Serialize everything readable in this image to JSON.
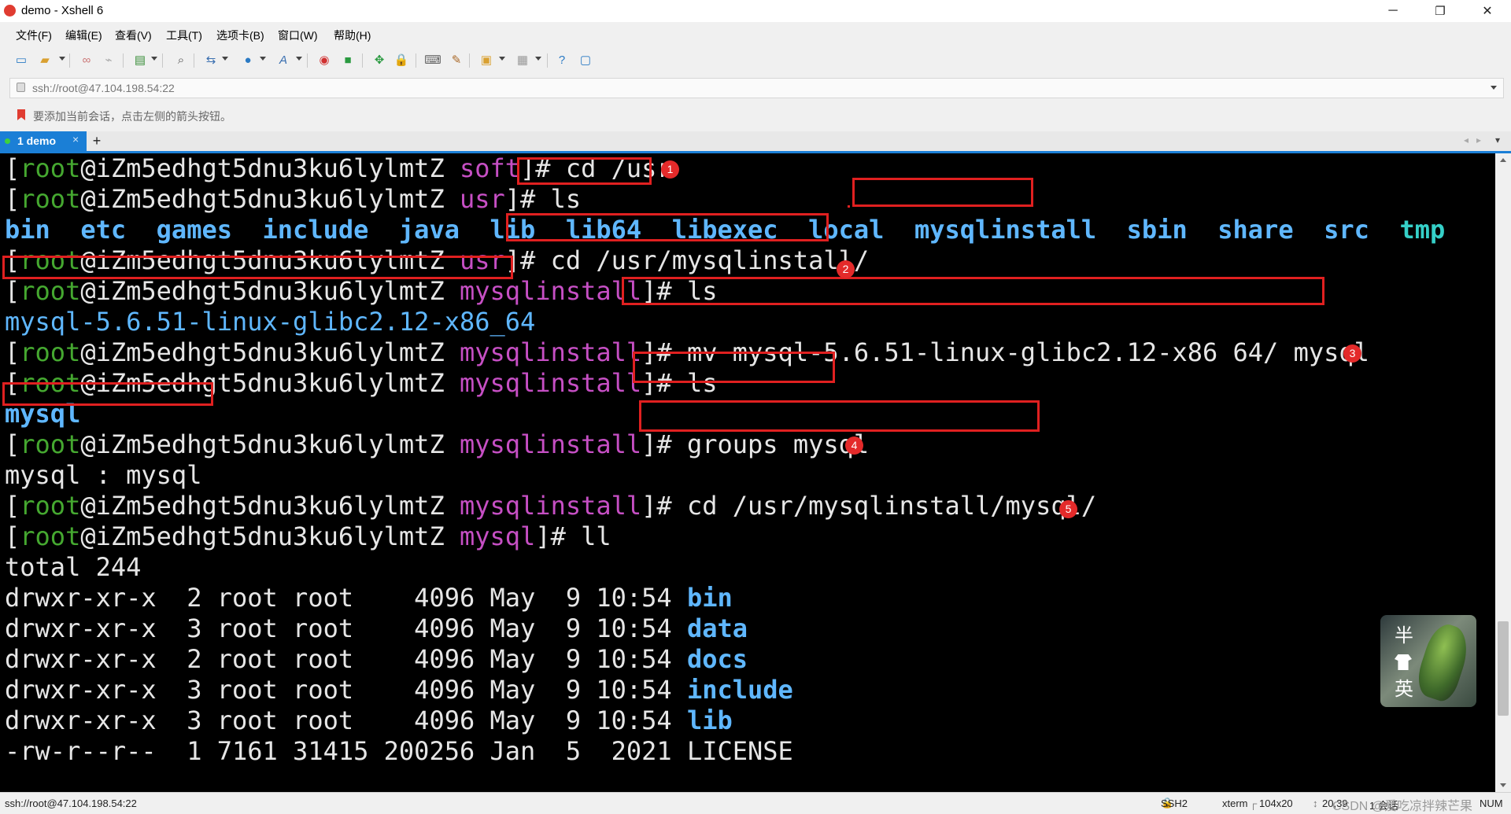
{
  "window": {
    "title": "demo - Xshell 6",
    "controls": {
      "minimize": "─",
      "restore": "❐",
      "close": "✕"
    }
  },
  "menu": [
    "文件(F)",
    "编辑(E)",
    "查看(V)",
    "工具(T)",
    "选项卡(B)",
    "窗口(W)",
    "帮助(H)"
  ],
  "toolbar_icons": [
    "new-session-icon",
    "open-folder-icon",
    "link-icon",
    "unlink-icon",
    "properties-icon",
    "search-icon",
    "transfer-icon",
    "globe-icon",
    "font-icon",
    "xftp-icon",
    "xmanager-icon",
    "fullscreen-icon",
    "lock-icon",
    "keyboard-icon",
    "script-icon",
    "compose-icon",
    "layout-icon",
    "help-icon",
    "chat-icon"
  ],
  "address": {
    "value": "ssh://root@47.104.198.54:22"
  },
  "hint": "要添加当前会话，点击左侧的箭头按钮。",
  "tab": {
    "label": "1 demo",
    "close": "×",
    "add": "+"
  },
  "terminal": {
    "user": "root",
    "host": "iZm5edhgt5dnu3ku6lylmtZ",
    "cmd1": {
      "dir": "soft",
      "command": "cd /usr"
    },
    "cmd2": {
      "dir": "usr",
      "command": "ls"
    },
    "ls_usr": [
      "bin",
      "etc",
      "games",
      "include",
      "java",
      "lib",
      "lib64",
      "libexec",
      "local",
      "mysqlinstall",
      "sbin",
      "share",
      "src",
      "tmp"
    ],
    "cmd3": {
      "dir": "usr",
      "command": "cd /usr/mysqlinstall/"
    },
    "cmd4": {
      "dir": "mysqlinstall",
      "command": "ls"
    },
    "ls_mysqlinstall": "mysql-5.6.51-linux-glibc2.12-x86_64",
    "cmd5": {
      "dir": "mysqlinstall",
      "command": "mv mysql-5.6.51-linux-glibc2.12-x86 64/ mysql"
    },
    "cmd6": {
      "dir": "mysqlinstall",
      "command": "ls"
    },
    "ls_after_mv": "mysql",
    "cmd7": {
      "dir": "mysqlinstall",
      "command": "groups mysql"
    },
    "groups_out": "mysql : mysql",
    "cmd8": {
      "dir": "mysqlinstall",
      "command": "cd /usr/mysqlinstall/mysql/"
    },
    "cmd9": {
      "dir": "mysql",
      "command": "ll"
    },
    "total": "total 244",
    "ll": [
      {
        "meta": "drwxr-xr-x  2 root root    4096 May  9 10:54 ",
        "name": "bin"
      },
      {
        "meta": "drwxr-xr-x  3 root root    4096 May  9 10:54 ",
        "name": "data"
      },
      {
        "meta": "drwxr-xr-x  2 root root    4096 May  9 10:54 ",
        "name": "docs"
      },
      {
        "meta": "drwxr-xr-x  3 root root    4096 May  9 10:54 ",
        "name": "include"
      },
      {
        "meta": "drwxr-xr-x  3 root root    4096 May  9 10:54 ",
        "name": "lib"
      },
      {
        "meta": "-rw-r--r--  1 7161 31415 200256 Jan  5  2021 ",
        "name": "LICENSE"
      }
    ],
    "annotations": [
      "1",
      "2",
      "3",
      "4",
      "5"
    ]
  },
  "avatar": {
    "char_top": "半",
    "char_bottom": "英"
  },
  "status": {
    "address": "ssh://root@47.104.198.54:22",
    "protocol": "SSH2",
    "term": "xterm",
    "size": "104x20",
    "cursor": "20,39",
    "sessions": "1 会话",
    "watermark": "CSDN @爱吃凉拌辣芒果",
    "num": "NUM"
  },
  "colors": {
    "terminal_bg": "#000000",
    "user": "#45a830",
    "dir": "#c64fc4",
    "folder": "#5fb7ff",
    "accent": "#1b7fd6",
    "highlight": "#e02020"
  }
}
